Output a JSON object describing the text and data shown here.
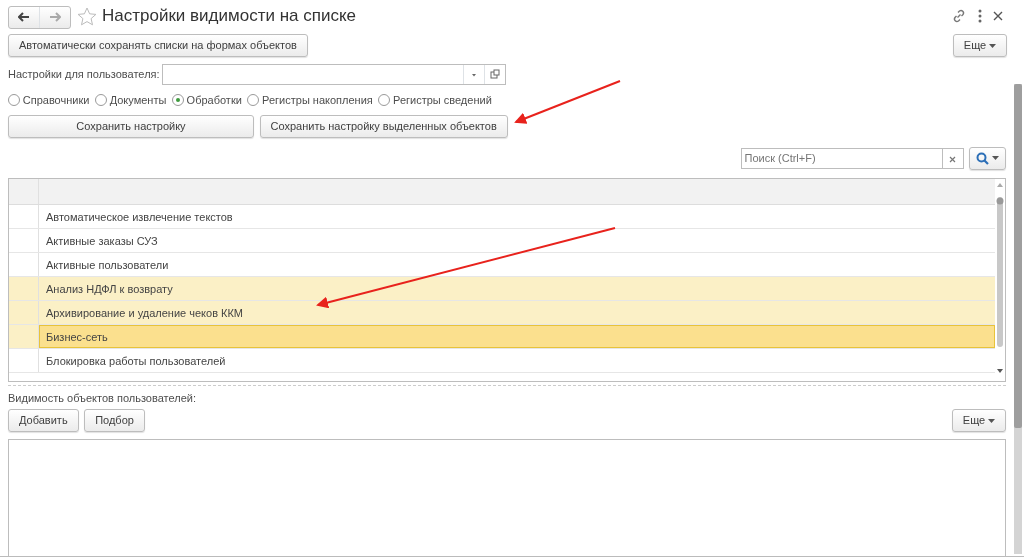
{
  "window": {
    "title": "Настройки видимости на списке",
    "favorite": false
  },
  "toolbar": {
    "auto_save_button": "Автоматически сохранять списки на формах объектов",
    "more_button": "Еще"
  },
  "user_field": {
    "label": "Настройки для пользователя:"
  },
  "object_types": [
    {
      "label": "Справочники",
      "selected": false
    },
    {
      "label": "Документы",
      "selected": false
    },
    {
      "label": "Обработки",
      "selected": true
    },
    {
      "label": "Регистры накопления",
      "selected": false
    },
    {
      "label": "Регистры сведений",
      "selected": false
    }
  ],
  "save_buttons": [
    "Сохранить настройку",
    "Сохранить настройку выделенных объектов"
  ],
  "search": {
    "placeholder": "Поиск (Ctrl+F)"
  },
  "table": {
    "rows": [
      {
        "name": "Автоматическое извлечение текстов",
        "selected": false,
        "current": false
      },
      {
        "name": "Активные заказы СУЗ",
        "selected": false,
        "current": false
      },
      {
        "name": "Активные пользователи",
        "selected": false,
        "current": false
      },
      {
        "name": "Анализ НДФЛ к возврату",
        "selected": true,
        "current": false
      },
      {
        "name": "Архивирование и удаление чеков ККМ",
        "selected": true,
        "current": false
      },
      {
        "name": "Бизнес-сеть",
        "selected": true,
        "current": true
      },
      {
        "name": "Блокировка работы пользователей",
        "selected": false,
        "current": false
      }
    ]
  },
  "visibility": {
    "label": "Видимость объектов пользователей:",
    "buttons": [
      "Добавить",
      "Подбор"
    ],
    "more_button": "Еще"
  }
}
